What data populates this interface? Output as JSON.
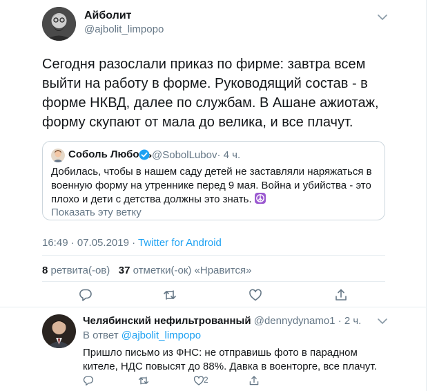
{
  "tweet": {
    "author_name": "Айболит",
    "author_handle": "@ajbolit_limpopo",
    "text": "Сегодня разослали приказ по фирме: завтра всем выйти на работу в форме. Руководящий состав - в форме НКВД, далее по службам. В Ашане ажиотаж, форму скупают от мала до велика, и все плачут.",
    "quoted": {
      "author_name": "Соболь Любовь",
      "author_handle": "@SobolLubov",
      "time": "· 4 ч.",
      "text": "Добилась, чтобы в нашем саду детей не заставляли наряжаться в военную форму на утреннике перед 9 мая. Война и убийства - это плохо и дети с детства должны это знать.",
      "show_thread": "Показать эту ветку"
    },
    "timestamp": "16:49 · 07.05.2019 · ",
    "source": "Twitter for Android",
    "retweets_count": "8",
    "retweets_label": " ретвита(-ов)",
    "likes_count": "37",
    "likes_label": " отметки(-ок) «Нравится»",
    "icons": [
      "reply-icon",
      "retweet-icon",
      "like-icon",
      "share-icon"
    ]
  },
  "reply": {
    "author_name": "Челябинский нефильтрованный",
    "author_handle": "@dennydynamo1",
    "time": " · 2 ч.",
    "reply_prefix": "В ответ ",
    "reply_to": "@ajbolit_limpopo",
    "text": "Пришло письмо из ФНС: не отправишь фото в парадном кителе, НДС повысят до 88%. Давка в военторге, все плачут.",
    "like_count": "2"
  },
  "colors": {
    "text": "#14171a",
    "secondary": "#657786",
    "link": "#1da1f2",
    "border": "#e6ecf0",
    "verified": "#1da1f2",
    "peace_emoji_bg": "#9b59d0"
  }
}
